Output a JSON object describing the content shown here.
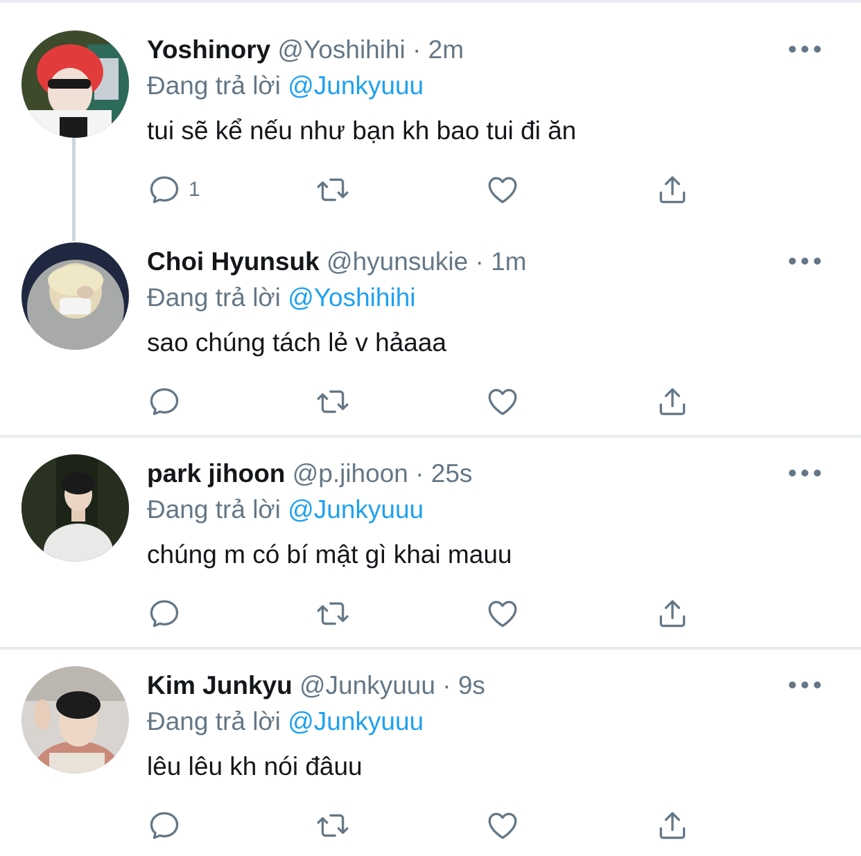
{
  "reply_prefix": "Đang trả lời",
  "tweets": [
    {
      "name": "Yoshinory",
      "handle": "@Yoshihihi",
      "separator": "·",
      "time": "2m",
      "reply_to": "@Junkyuuu",
      "text": "tui sẽ kể nếu như bạn kh bao tui đi ăn",
      "reply_count": "1",
      "threaded": true
    },
    {
      "name": "Choi Hyunsuk",
      "handle": "@hyunsukie",
      "separator": "·",
      "time": "1m",
      "reply_to": "@Yoshihihi",
      "text": "sao chúng tách lẻ v hảaaa",
      "reply_count": ""
    },
    {
      "name": "park jihoon",
      "handle": "@p.jihoon",
      "separator": "·",
      "time": "25s",
      "reply_to": "@Junkyuuu",
      "text": "chúng m có bí mật gì khai mauu",
      "reply_count": ""
    },
    {
      "name": "Kim Junkyu",
      "handle": "@Junkyuuu",
      "separator": "·",
      "time": "9s",
      "reply_to": "@Junkyuuu",
      "text": "lêu lêu kh nói đâuu",
      "reply_count": ""
    }
  ],
  "colors": {
    "link": "#1da1f2",
    "secondary_text": "#657786",
    "primary_text": "#14171a",
    "divider": "#e6ecf0"
  },
  "icons": [
    "reply-icon",
    "retweet-icon",
    "like-icon",
    "share-icon",
    "more-icon"
  ]
}
